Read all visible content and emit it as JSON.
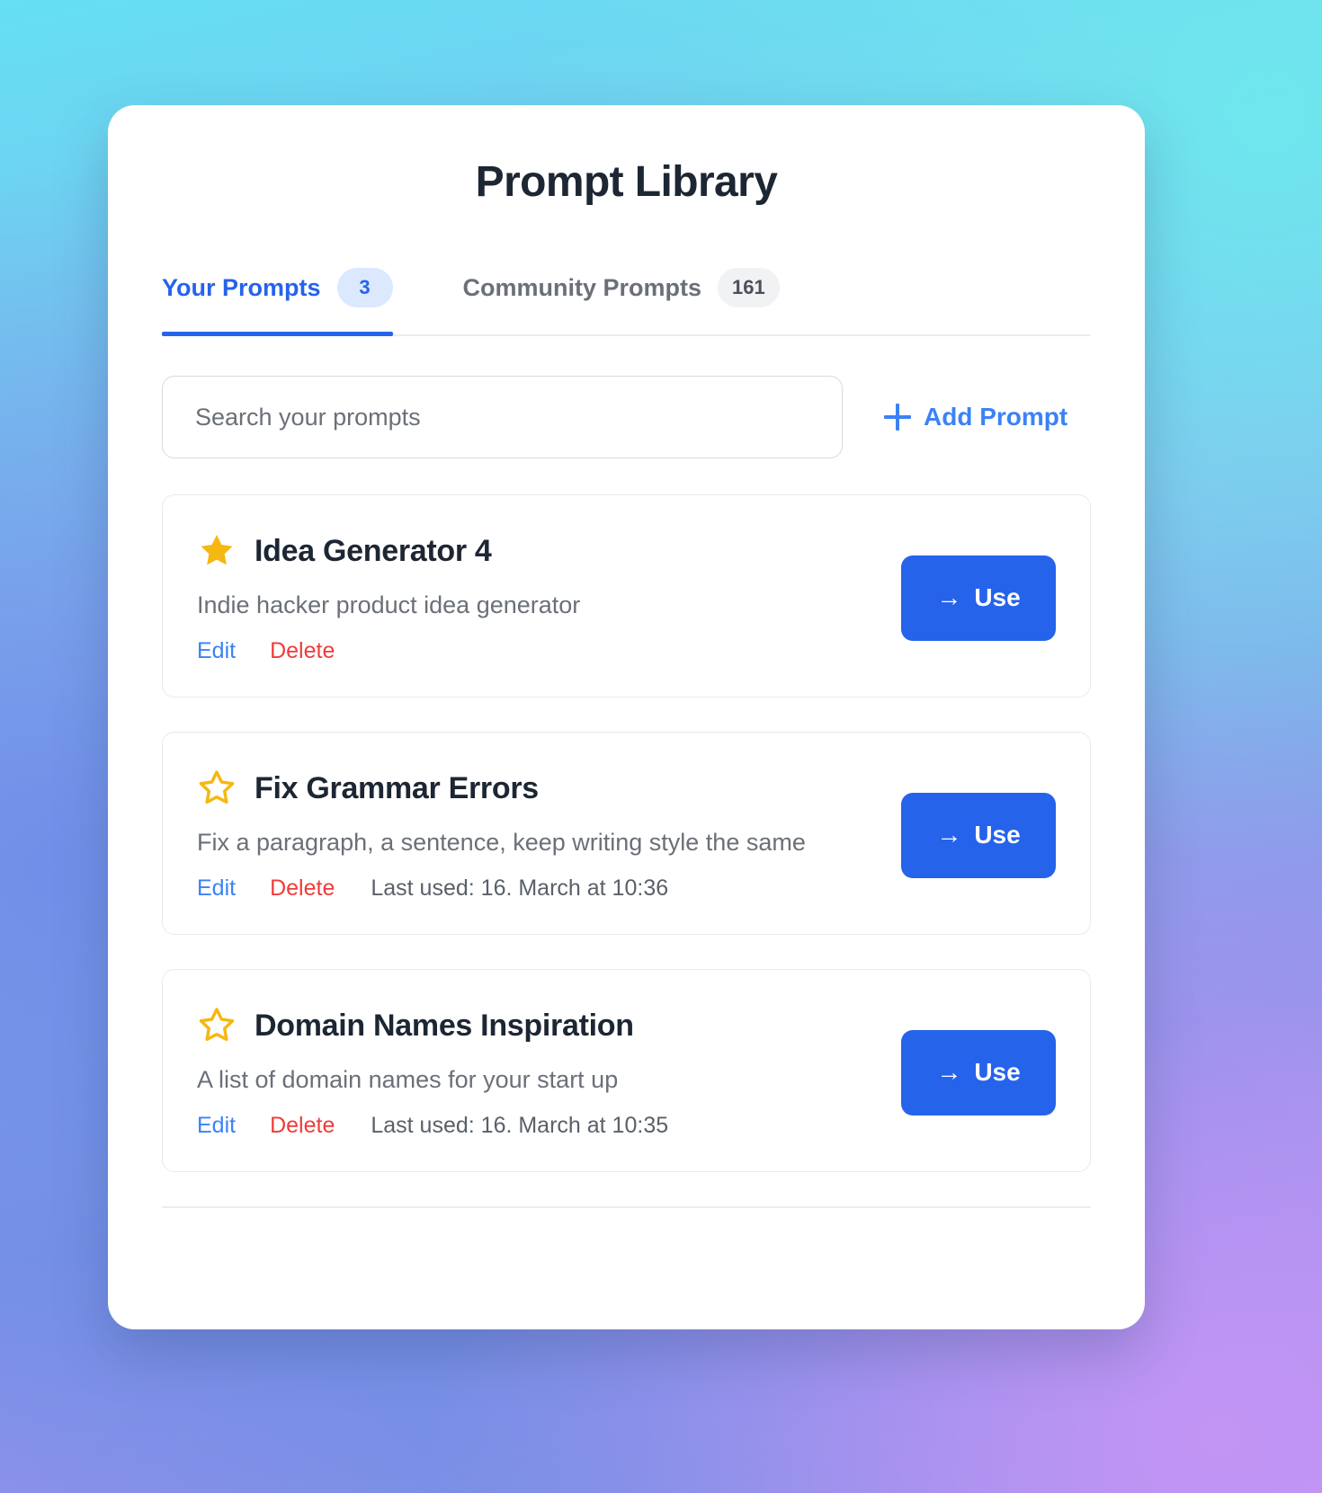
{
  "page": {
    "title": "Prompt Library"
  },
  "tabs": [
    {
      "label": "Your Prompts",
      "badge": "3",
      "active": true
    },
    {
      "label": "Community Prompts",
      "badge": "161",
      "active": false
    }
  ],
  "search": {
    "value": "",
    "placeholder": "Search your prompts"
  },
  "add_prompt": {
    "label": "Add Prompt",
    "icon": "plus-icon"
  },
  "actions": {
    "edit_label": "Edit",
    "delete_label": "Delete",
    "use_label": "Use",
    "use_icon": "arrow-right-icon"
  },
  "prompts": [
    {
      "title": "Idea Generator 4",
      "description": "Indie hacker product idea generator",
      "favorite": true,
      "star_icon": "star-filled-icon",
      "last_used": ""
    },
    {
      "title": "Fix Grammar Errors",
      "description": "Fix a paragraph, a sentence, keep writing style the same",
      "favorite": false,
      "star_icon": "star-outline-icon",
      "last_used": "Last used: 16. March at 10:36"
    },
    {
      "title": "Domain Names Inspiration",
      "description": "A list of domain names for your start up",
      "favorite": false,
      "star_icon": "star-outline-icon",
      "last_used": "Last used: 16. March at 10:35"
    }
  ],
  "colors": {
    "accent_blue": "#2563eb",
    "link_blue": "#3b82f6",
    "delete_red": "#ef3b3b",
    "star_gold": "#f5b812",
    "title_dark": "#1d2633",
    "muted_gray": "#6b7078"
  }
}
